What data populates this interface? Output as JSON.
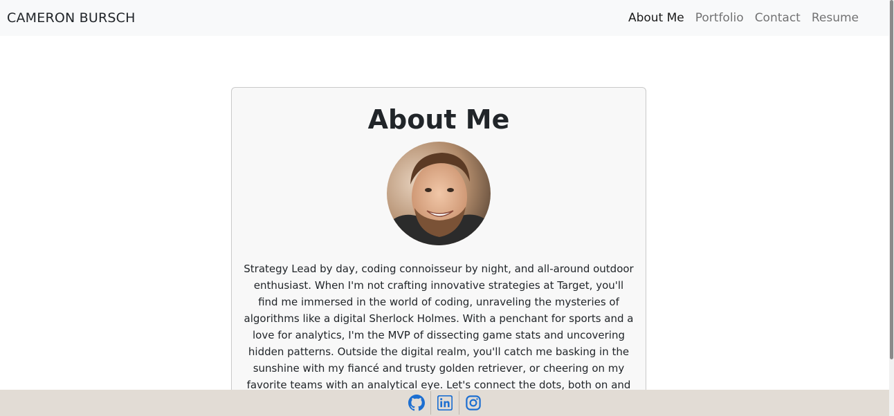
{
  "navbar": {
    "brand": "CAMERON BURSCH",
    "links": [
      "About Me",
      "Portfolio",
      "Contact",
      "Resume"
    ],
    "active": "About Me"
  },
  "about": {
    "title": "About Me",
    "avatar_alt": "profile-photo",
    "bio": "Strategy Lead by day, coding connoisseur by night, and all-around outdoor enthusiast. When I'm not crafting innovative strategies at Target, you'll find me immersed in the world of coding, unraveling the mysteries of algorithms like a digital Sherlock Holmes. With a penchant for sports and a love for analytics, I'm the MVP of dissecting game stats and uncovering hidden patterns. Outside the digital realm, you'll catch me basking in the sunshine with my fiancé and trusty golden retriever, or cheering on my favorite teams with an analytical eye. Let's connect the dots, both on and off the field!"
  },
  "footer": {
    "icons": [
      "github-icon",
      "linkedin-icon",
      "instagram-icon"
    ]
  },
  "colors": {
    "navbar_bg": "#f8f9fa",
    "footer_bg": "#e2dcd5",
    "icon_blue": "#1d6fd1",
    "card_bg": "#f8f8f8"
  }
}
